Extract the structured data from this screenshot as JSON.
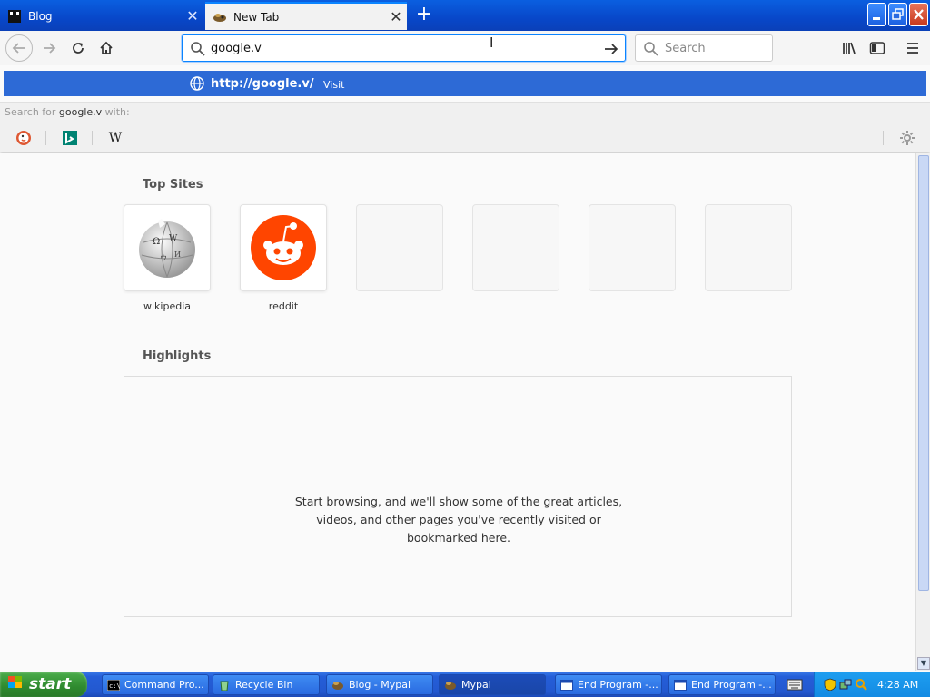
{
  "window": {
    "tabs": [
      {
        "title": "Blog",
        "active": false
      },
      {
        "title": "New Tab",
        "active": true
      }
    ],
    "new_tab_symbol": "+",
    "minimize": "_",
    "maximize": "❐",
    "close": "✕"
  },
  "navbar": {
    "url_value": "google.v",
    "search_placeholder": "Search"
  },
  "autocomplete": {
    "url": "http://google.v/",
    "separator": "—",
    "action": "Visit",
    "search_with_prefix": "Search for ",
    "search_with_term": "google.v",
    "search_with_suffix": " with:",
    "engines": [
      "duckduckgo-icon",
      "bing-icon",
      "wikipedia-icon"
    ],
    "wiki_letter": "W"
  },
  "newtab": {
    "top_sites_title": "Top Sites",
    "top_sites": [
      {
        "label": "wikipedia",
        "icon": "wikipedia-globe-icon"
      },
      {
        "label": "reddit",
        "icon": "reddit-icon"
      },
      {
        "label": ""
      },
      {
        "label": ""
      },
      {
        "label": ""
      },
      {
        "label": ""
      }
    ],
    "highlights_title": "Highlights",
    "highlights_empty_line1": "Start browsing, and we'll show some of the great articles,",
    "highlights_empty_line2": "videos, and other pages you've recently visited or",
    "highlights_empty_line3": "bookmarked here."
  },
  "taskbar": {
    "start_label": "start",
    "tasks": [
      {
        "label": "Command Pro...",
        "active": false
      },
      {
        "label": "Recycle Bin",
        "active": false
      },
      {
        "label": "Blog - Mypal",
        "active": false
      },
      {
        "label": "Mypal",
        "active": true
      },
      {
        "label": "End Program -...",
        "active": false
      },
      {
        "label": "End Program -...",
        "active": false
      }
    ],
    "clock": "4:28 AM"
  },
  "colors": {
    "accent": "#0a84ff",
    "suggest_highlight": "#2d6ad6",
    "titlebar": "#0a5fe0",
    "taskbar": "#245ed8",
    "start_green": "#2f8a2f",
    "reddit": "#ff4500"
  }
}
